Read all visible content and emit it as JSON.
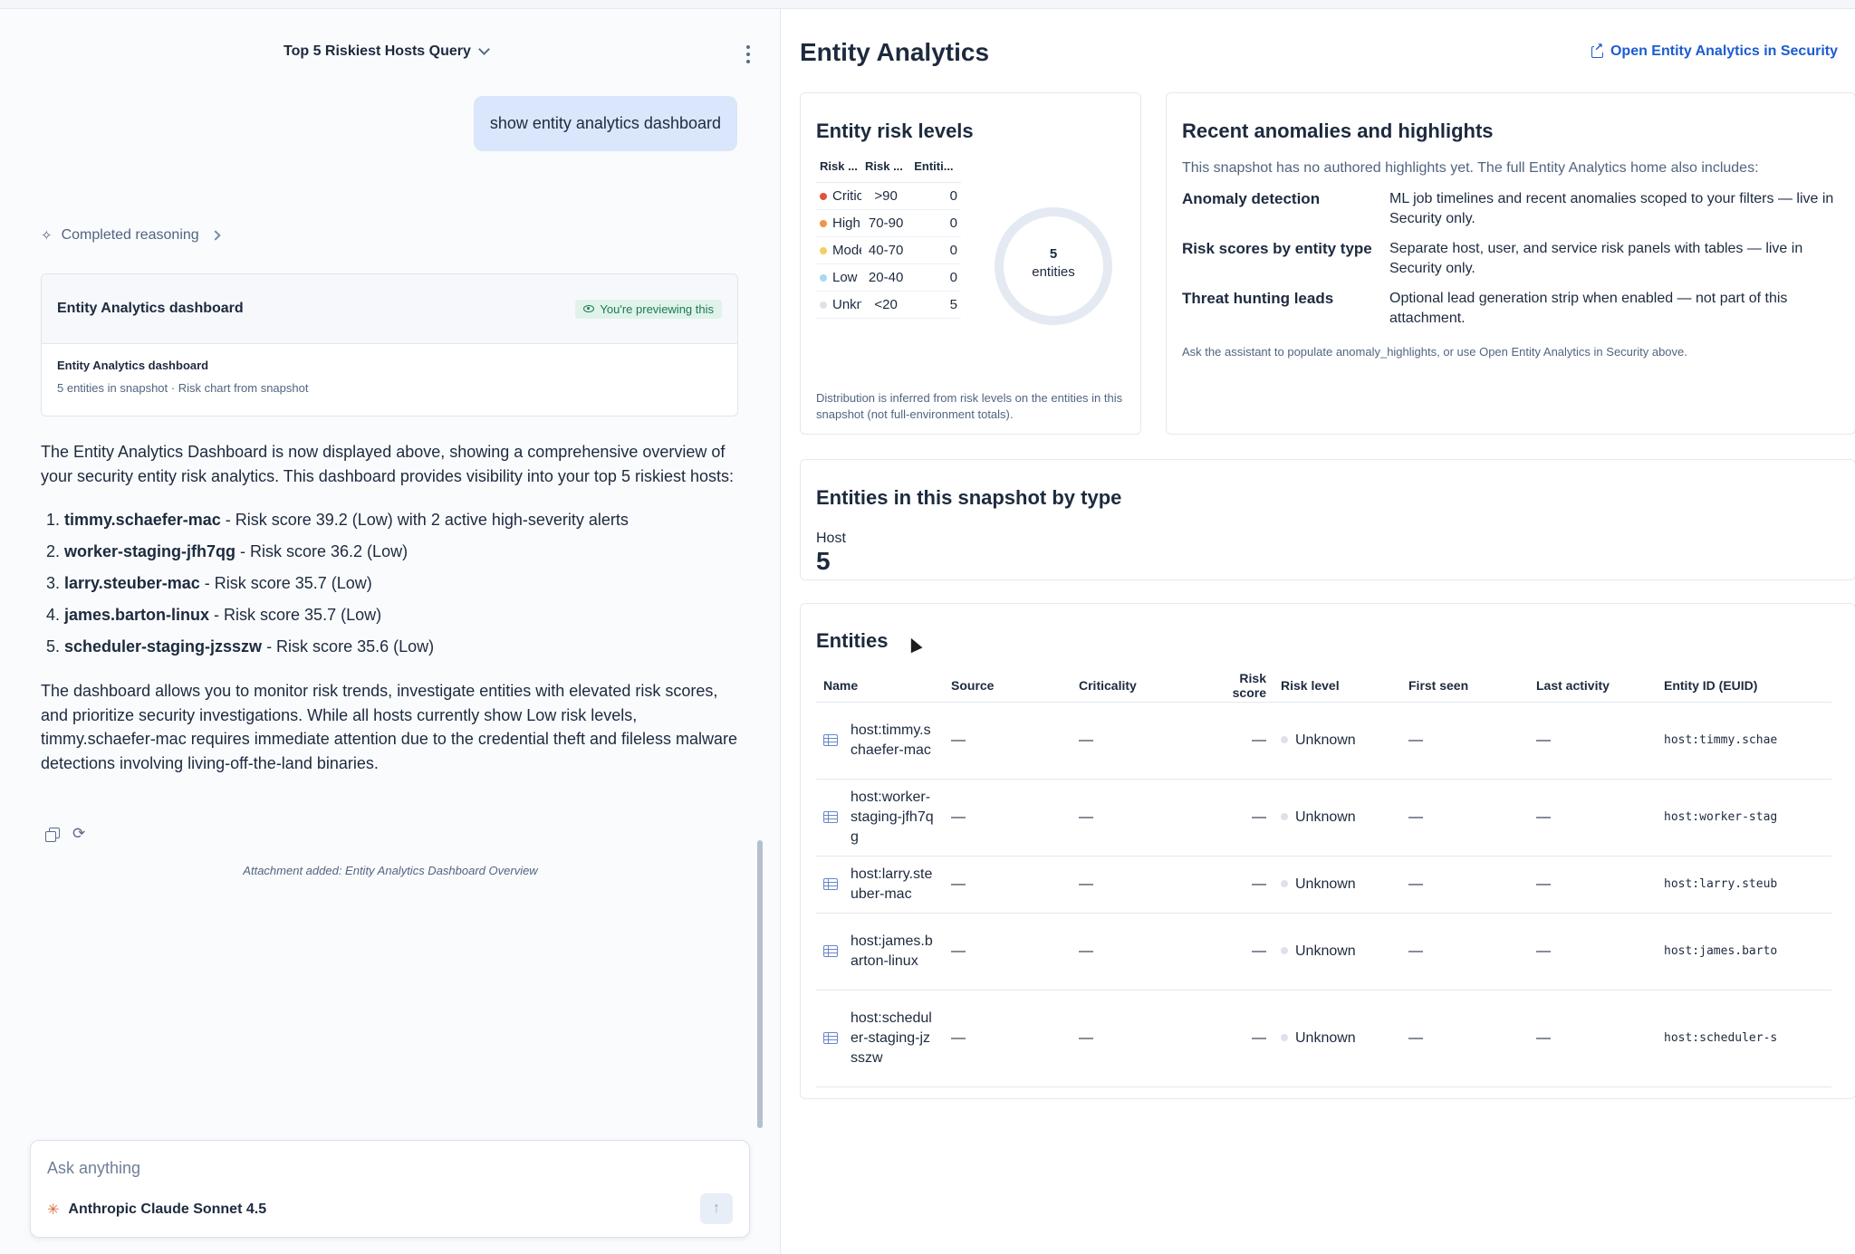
{
  "chat": {
    "conversation_title": "Top 5 Riskiest Hosts Query",
    "user_message": "show entity analytics dashboard",
    "reasoning_label": "Completed reasoning",
    "attachment_card": {
      "header_title": "Entity Analytics dashboard",
      "badge": "You're previewing this",
      "body_title": "Entity Analytics dashboard",
      "body_subtitle": "5 entities in snapshot · Risk chart from snapshot"
    },
    "response": {
      "intro": "The Entity Analytics Dashboard is now displayed above, showing a comprehensive overview of your security entity risk analytics. This dashboard provides visibility into your top 5 riskiest hosts:",
      "hosts": [
        {
          "name": "timmy.schaefer-mac",
          "detail": " - Risk score 39.2 (Low) with 2 active high-severity alerts"
        },
        {
          "name": "worker-staging-jfh7qg",
          "detail": " - Risk score 36.2 (Low)"
        },
        {
          "name": "larry.steuber-mac",
          "detail": " - Risk score 35.7 (Low)"
        },
        {
          "name": "james.barton-linux",
          "detail": " - Risk score 35.7 (Low)"
        },
        {
          "name": "scheduler-staging-jzsszw",
          "detail": " - Risk score 35.6 (Low)"
        }
      ],
      "outro": "The dashboard allows you to monitor risk trends, investigate entities with elevated risk scores, and prioritize security investigations. While all hosts currently show Low risk levels, timmy.schaefer-mac requires immediate attention due to the credential theft and fileless malware detections involving living-off-the-land binaries."
    },
    "attachment_note": "Attachment added: Entity Analytics Dashboard Overview",
    "composer": {
      "placeholder": "Ask anything",
      "model": "Anthropic Claude Sonnet 4.5",
      "send_symbol": "↑"
    }
  },
  "dashboard": {
    "title": "Entity Analytics",
    "open_link": "Open Entity Analytics in Security",
    "risk_levels": {
      "title": "Entity risk levels",
      "headers": [
        "Risk ...",
        "Risk ...",
        "Entiti..."
      ],
      "rows": [
        {
          "level": "Critical",
          "range": ">90",
          "count": "0",
          "color": "#e0533e"
        },
        {
          "level": "High",
          "range": "70-90",
          "count": "0",
          "color": "#f0944a"
        },
        {
          "level": "Moderate",
          "range": "40-70",
          "count": "0",
          "color": "#f4cf5e"
        },
        {
          "level": "Low",
          "range": "20-40",
          "count": "0",
          "color": "#a9d8ef"
        },
        {
          "level": "Unknown",
          "range": "<20",
          "count": "5",
          "color": "#dde2ea"
        }
      ],
      "donut_value": "5",
      "donut_unit": "entities",
      "note": "Distribution is inferred from risk levels on the entities in this snapshot (not full-environment totals)."
    },
    "anomalies": {
      "title": "Recent anomalies and highlights",
      "intro": "This snapshot has no authored highlights yet. The full Entity Analytics home also includes:",
      "items": [
        {
          "key": "Anomaly detection",
          "value": "ML job timelines and recent anomalies scoped to your filters — live in Security only."
        },
        {
          "key": "Risk scores by entity type",
          "value": "Separate host, user, and service risk panels with tables — live in Security only."
        },
        {
          "key": "Threat hunting leads",
          "value": "Optional lead generation strip when enabled — not part of this attachment."
        }
      ],
      "footer": "Ask the assistant to populate anomaly_highlights, or use Open Entity Analytics in Security above."
    },
    "by_type": {
      "title": "Entities in this snapshot by type",
      "label": "Host",
      "count": "5"
    },
    "entities": {
      "title": "Entities",
      "columns": [
        "Name",
        "Source",
        "Criticality",
        "Risk score",
        "Risk level",
        "First seen",
        "Last activity",
        "Entity ID (EUID)"
      ],
      "rows": [
        {
          "name": "host:timmy.schaefer-mac",
          "source": "—",
          "criticality": "—",
          "risk_score": "—",
          "risk_level": "Unknown",
          "first_seen": "—",
          "last_activity": "—",
          "euid": "host:timmy.schae"
        },
        {
          "name": "host:worker-staging-jfh7qg",
          "source": "—",
          "criticality": "—",
          "risk_score": "—",
          "risk_level": "Unknown",
          "first_seen": "—",
          "last_activity": "—",
          "euid": "host:worker-stag"
        },
        {
          "name": "host:larry.steuber-mac",
          "source": "—",
          "criticality": "—",
          "risk_score": "—",
          "risk_level": "Unknown",
          "first_seen": "—",
          "last_activity": "—",
          "euid": "host:larry.steub"
        },
        {
          "name": "host:james.barton-linux",
          "source": "—",
          "criticality": "—",
          "risk_score": "—",
          "risk_level": "Unknown",
          "first_seen": "—",
          "last_activity": "—",
          "euid": "host:james.barto"
        },
        {
          "name": "host:scheduler-staging-jzsszw",
          "source": "—",
          "criticality": "—",
          "risk_score": "—",
          "risk_level": "Unknown",
          "first_seen": "—",
          "last_activity": "—",
          "euid": "host:scheduler-s"
        }
      ]
    }
  }
}
